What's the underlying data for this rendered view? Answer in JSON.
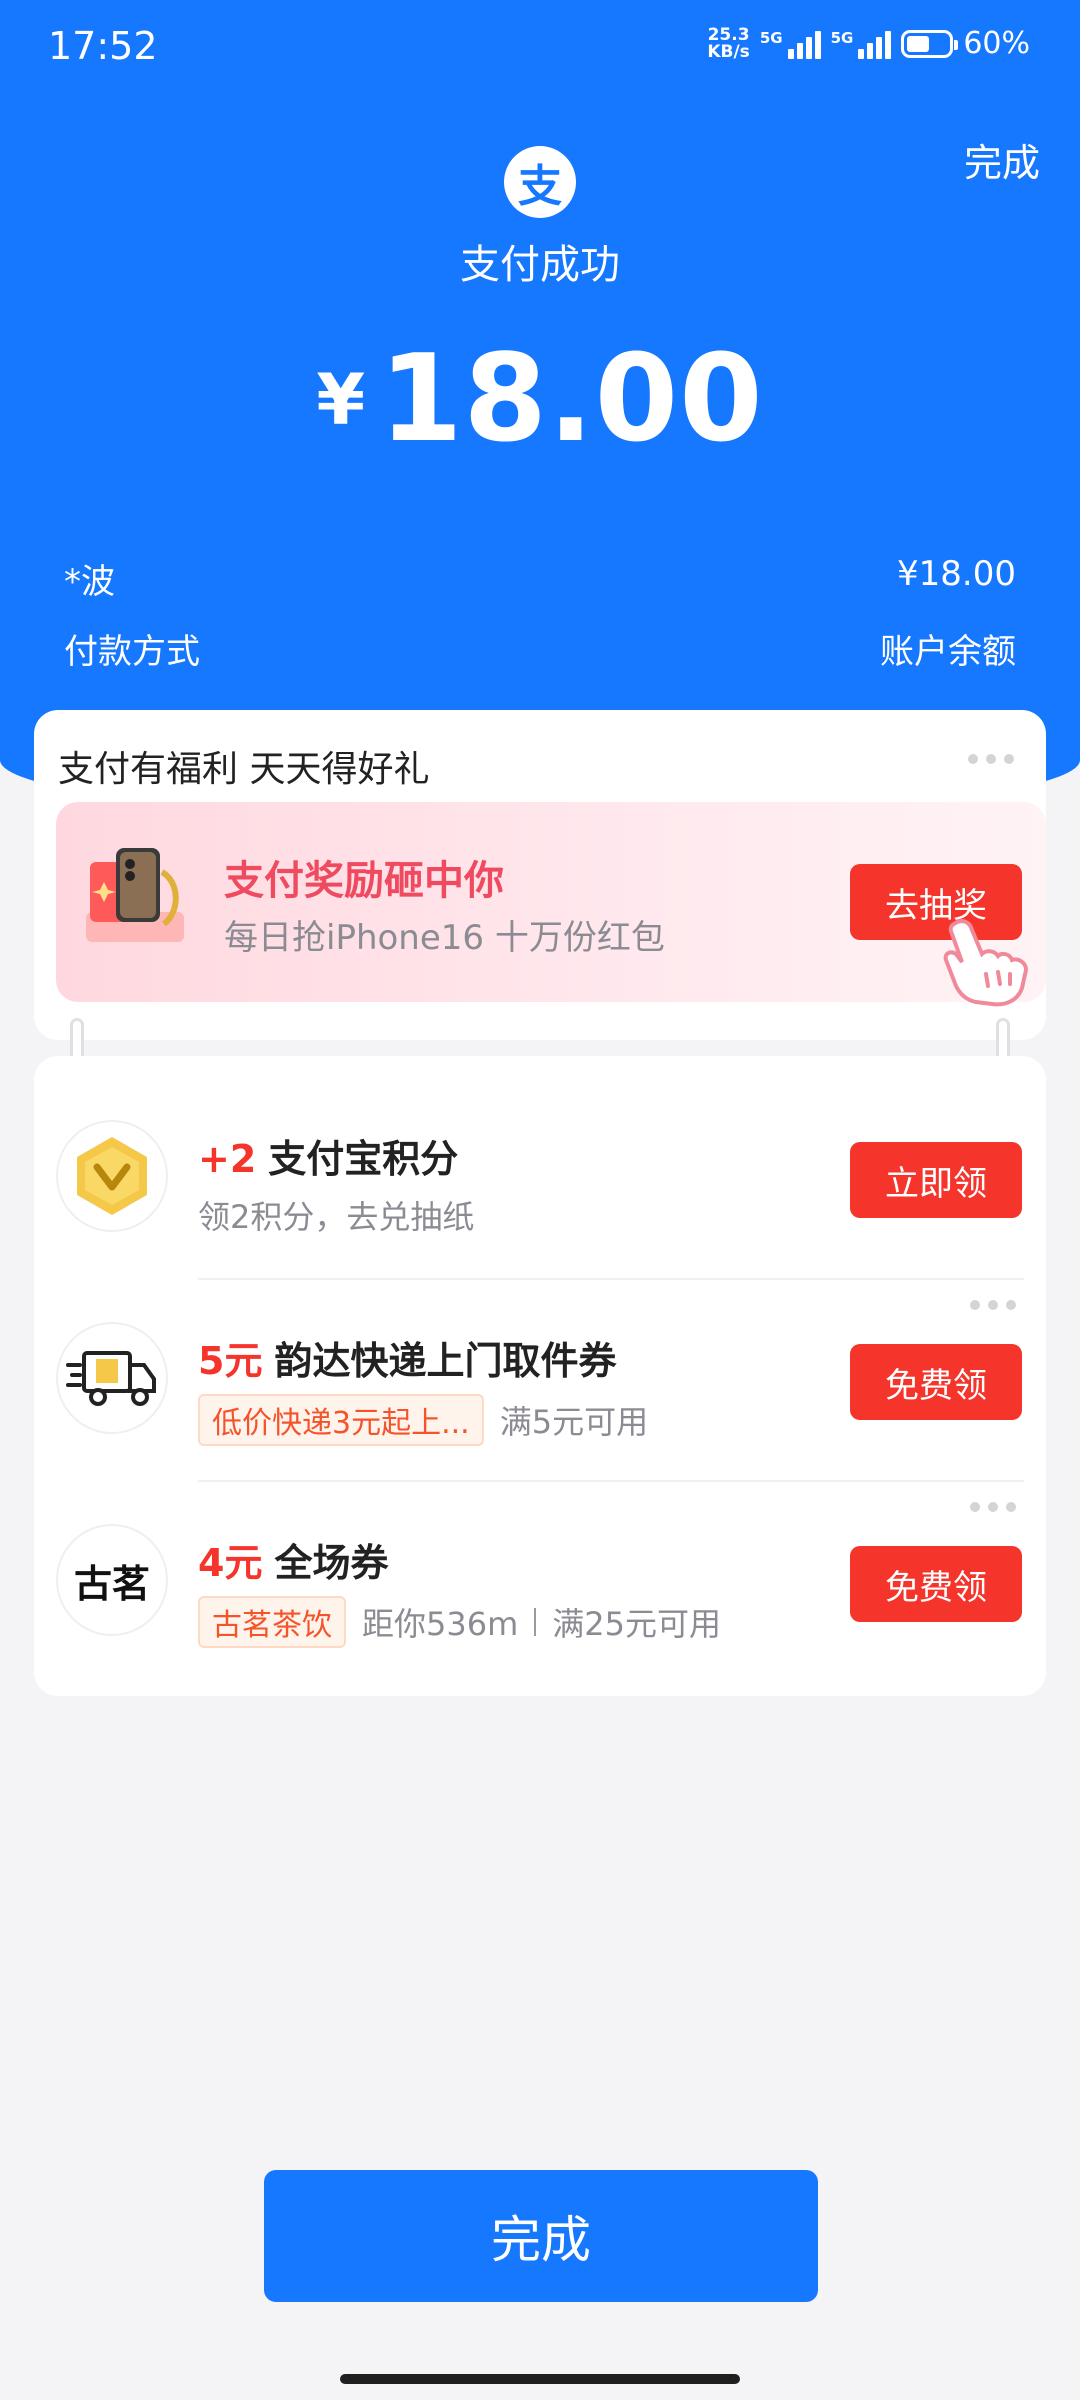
{
  "status_bar": {
    "time": "17:52",
    "net_speed_value": "25.3",
    "net_speed_unit": "KB/s",
    "sim1_label": "5G",
    "sim2_label": "5G",
    "battery_percent": "60%",
    "battery_level": 0.6
  },
  "header": {
    "done_label": "完成",
    "logo_char": "支",
    "status_text": "支付成功",
    "currency": "¥",
    "amount": "18.00"
  },
  "payee": {
    "name": "*波",
    "amount": "¥18.00"
  },
  "labels": {
    "payment_method": "付款方式",
    "account_balance": "账户余额"
  },
  "benefits_card": {
    "title": "支付有福利 天天得好礼",
    "promo": {
      "title": "支付奖励砸中你",
      "subtitle": "每日抢iPhone16 十万份红包",
      "button": "去抽奖"
    }
  },
  "rewards": [
    {
      "highlight": "+2",
      "title": "支付宝积分",
      "subtitle": "领2积分，去兑抽纸",
      "button": "立即领"
    },
    {
      "highlight": "5元",
      "title": "韵达快递上门取件券",
      "tag": "低价快递3元起上...",
      "subtitle": "满5元可用",
      "button": "免费领"
    },
    {
      "highlight": "4元",
      "title": "全场券",
      "logo_text": "古茗",
      "tag": "古茗茶饮",
      "distance": "距你536m",
      "subtitle": "满25元可用",
      "button": "免费领"
    }
  ],
  "footer": {
    "done_button": "完成"
  },
  "colors": {
    "brand_blue": "#1677ff",
    "action_red": "#f5342b",
    "promo_red": "#ef4a5f"
  }
}
